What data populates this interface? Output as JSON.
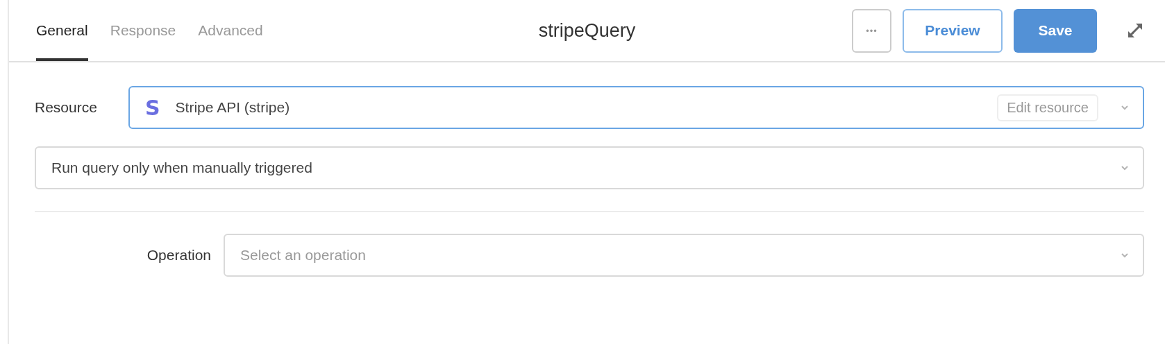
{
  "tabs": [
    {
      "label": "General",
      "selected": true
    },
    {
      "label": "Response",
      "selected": false
    },
    {
      "label": "Advanced",
      "selected": false
    }
  ],
  "title": "stripeQuery",
  "actions": {
    "more": "•••",
    "preview": "Preview",
    "save": "Save"
  },
  "resource": {
    "label": "Resource",
    "logo": "S",
    "value": "Stripe API (stripe)",
    "edit": "Edit resource",
    "focused": true
  },
  "trigger": {
    "value": "Run query only when manually triggered"
  },
  "operation": {
    "label": "Operation",
    "placeholder": "Select an operation"
  }
}
